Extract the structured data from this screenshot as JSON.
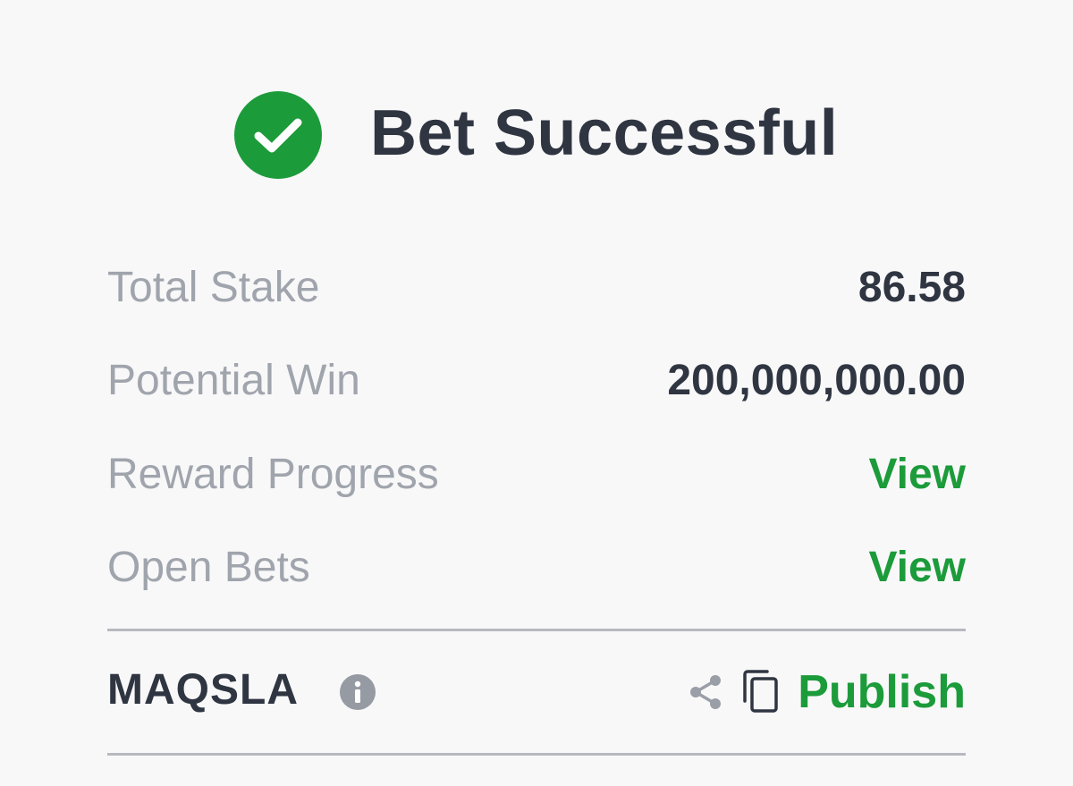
{
  "header": {
    "icon": "check-circle-icon",
    "title": "Bet Successful"
  },
  "summary": [
    {
      "label": "Total Stake",
      "value": "86.58",
      "type": "text"
    },
    {
      "label": "Potential Win",
      "value": "200,000,000.00",
      "type": "text"
    },
    {
      "label": "Reward Progress",
      "value": "View",
      "type": "link"
    },
    {
      "label": "Open Bets",
      "value": "View",
      "type": "link"
    }
  ],
  "footer": {
    "code": "MAQSLA",
    "info_icon": "info-icon",
    "share_icon": "share-icon",
    "copy_icon": "copy-icon",
    "publish_label": "Publish"
  },
  "colors": {
    "accent_green": "#1c9b3a",
    "text_dark": "#2f3541",
    "text_muted": "#a0a4ac",
    "background": "#f8f8f9"
  }
}
